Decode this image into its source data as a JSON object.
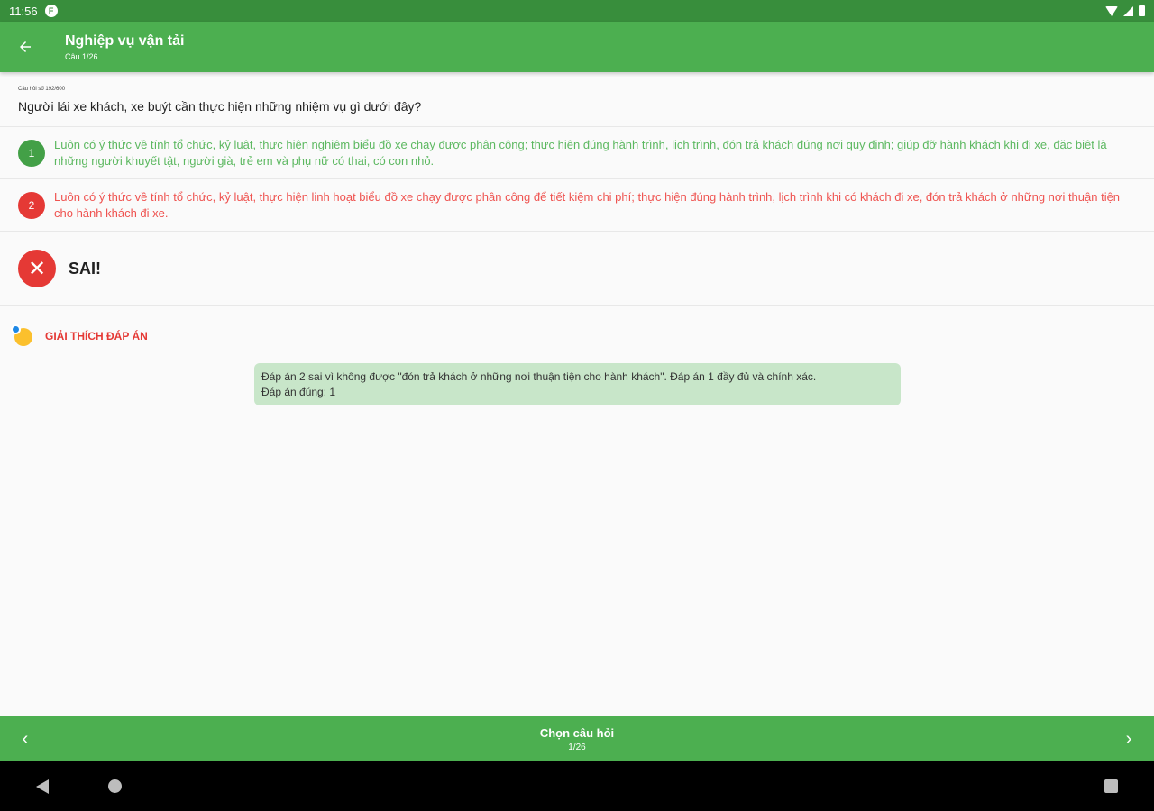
{
  "status_bar": {
    "time": "11:56",
    "app_icon_glyph": "F"
  },
  "app_bar": {
    "title": "Nghiệp vụ vận tải",
    "subtitle": "Câu 1/26"
  },
  "question": {
    "meta": "Câu hỏi số 192/600",
    "text": "Người lái xe khách, xe buýt cần thực hiện những nhiệm vụ gì dưới đây?"
  },
  "answers": [
    {
      "number": "1",
      "status": "correct",
      "text": "Luôn có ý thức về tính tổ chức, kỷ luật, thực hiện nghiêm biểu đồ xe chạy được phân công; thực hiện đúng hành trình, lịch trình, đón trả khách đúng nơi quy định; giúp đỡ hành khách khi đi xe, đặc biệt là những người khuyết tật, người già, trẻ em và phụ nữ có thai, có con nhỏ."
    },
    {
      "number": "2",
      "status": "wrong",
      "text": "Luôn có ý thức về tính tổ chức, kỷ luật, thực hiện linh hoạt biểu đồ xe chạy được phân công để tiết kiệm chi phí; thực hiện đúng hành trình, lịch trình khi có khách đi xe, đón trả khách ở những nơi thuận tiện cho hành khách đi xe."
    }
  ],
  "result": {
    "icon_glyph": "✕",
    "label": "SAI!"
  },
  "explanation": {
    "title": "GIẢI THÍCH ĐÁP ÁN",
    "line1": "Đáp án 2 sai vì không được \"đón trả khách ở những nơi thuận tiện cho hành khách\". Đáp án 1 đầy đủ và chính xác.",
    "line2": "Đáp án đúng: 1"
  },
  "bottom_bar": {
    "prev_glyph": "‹",
    "next_glyph": "›",
    "title": "Chọn câu hỏi",
    "count": "1/26"
  },
  "colors": {
    "primary": "#4caf50",
    "primary_dark": "#388e3c",
    "correct": "#43a047",
    "wrong": "#e53935",
    "explain_bg": "#c8e6c9"
  }
}
